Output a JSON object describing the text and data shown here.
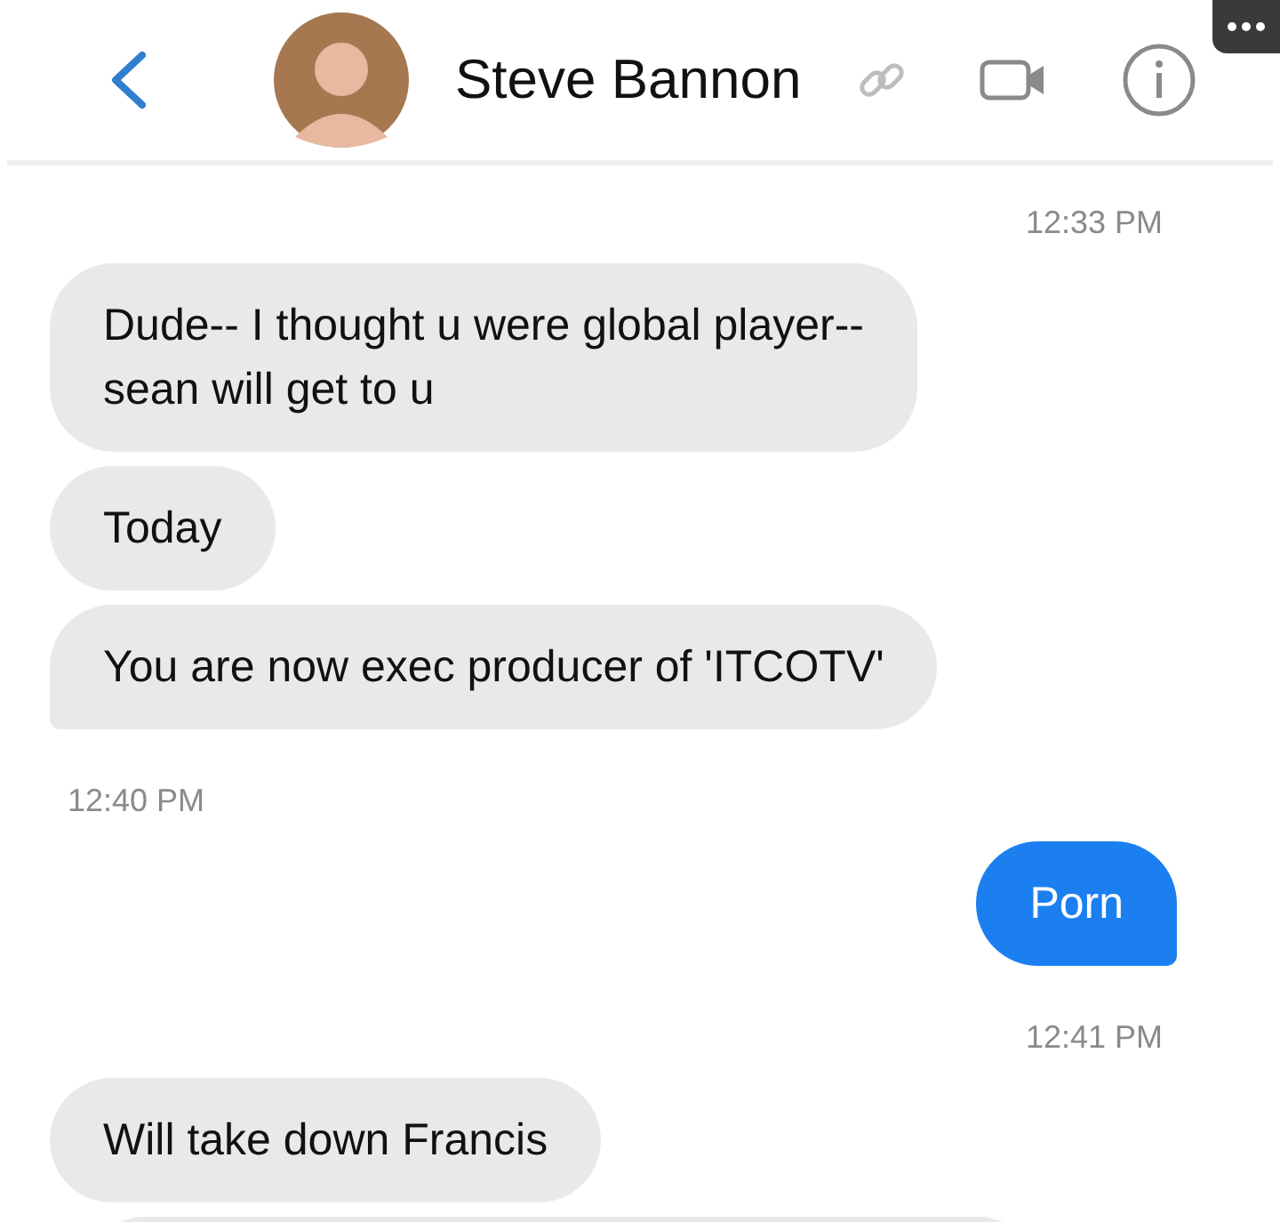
{
  "header": {
    "title": "Steve Bannon"
  },
  "messages": [
    {
      "kind": "time_right",
      "text": "12:33 PM"
    },
    {
      "kind": "incoming",
      "text": "Dude-- I thought u were global player--\nsean will get to u",
      "tail": false
    },
    {
      "kind": "incoming",
      "text": "Today",
      "tail": false
    },
    {
      "kind": "incoming",
      "text": "You are now exec producer of 'ITCOTV'",
      "tail": true
    },
    {
      "kind": "time_left",
      "text": "12:40 PM"
    },
    {
      "kind": "outgoing",
      "text": "Porn",
      "tail": true
    },
    {
      "kind": "time_right",
      "text": "12:41 PM"
    },
    {
      "kind": "incoming",
      "text": "Will take down Francis",
      "tail": false
    },
    {
      "kind": "partial"
    }
  ]
}
